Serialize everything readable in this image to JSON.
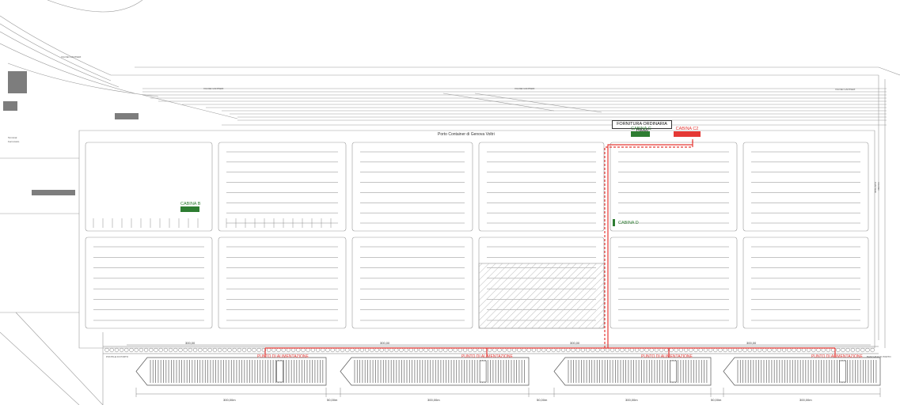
{
  "title": "Porto Container di Genova Voltri",
  "fornitura_label": "FORNITURA ORDINARIA 15MW",
  "cabins": {
    "b": {
      "label": "CABINA B",
      "color": "#2e7d32"
    },
    "c": {
      "label": "CABINA C",
      "color": "#2e7d32"
    },
    "c2": {
      "label": "CABINA C2",
      "color": "#e53935"
    },
    "d": {
      "label": "CABINA D",
      "color": "#2e7d32"
    }
  },
  "feed_points": {
    "label": "PUNTO DI ALIMENTAZIONE",
    "color": "#e53935"
  },
  "road_labels": [
    "VIA DEI CANTIERI",
    "VIA DEI CANTIERI",
    "VIA DEI CANTIERI",
    "VIA DEI CANTIERI",
    "VIA DEI CANTIERI"
  ],
  "quay_dimensions": [
    "300,00",
    "300,00",
    "300,00",
    "300,00"
  ],
  "ship_dimensions": [
    "300,00m",
    "50,00m",
    "300,00m",
    "50,00m",
    "300,00m",
    "50,00m",
    "300,00m"
  ],
  "quay_end_labels": [
    "PONTILE DI PORTO",
    "BANCHINA DI PORTO"
  ],
  "small_text": [
    "Terminal",
    "Ferroviario"
  ]
}
